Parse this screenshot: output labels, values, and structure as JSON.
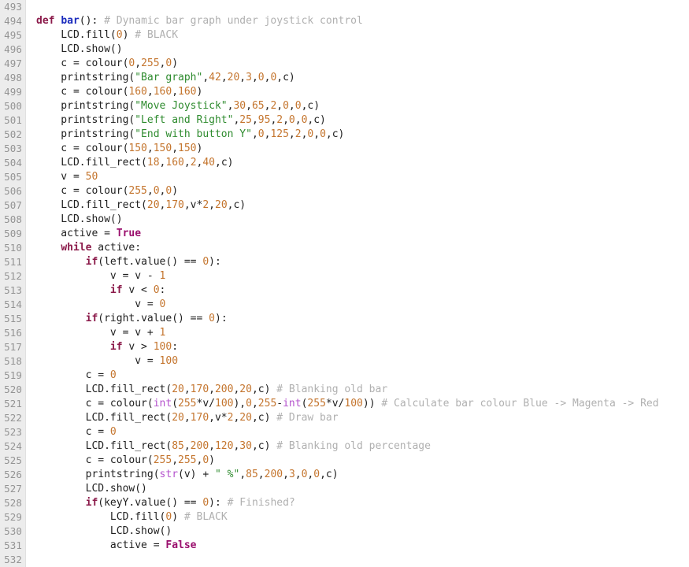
{
  "editor": {
    "name": "python-code-viewer",
    "language": "Python",
    "first_line_number": 493,
    "last_line_number": 532,
    "colors": {
      "background": "#ffffff",
      "gutter_background": "#ececec",
      "gutter_text": "#949494",
      "default_text": "#202020",
      "keyword": "#8b1a4a",
      "constant": "#9a0f6d",
      "function_def": "#1a2bbd",
      "builtin": "#b452cd",
      "string": "#2e8b2e",
      "number": "#c4752e",
      "comment": "#b0b0b0"
    }
  },
  "lines": [
    {
      "n": "493",
      "tokens": []
    },
    {
      "n": "494",
      "tokens": [
        {
          "t": "kw",
          "s": "def"
        },
        {
          "t": "plain",
          "s": " "
        },
        {
          "t": "fn",
          "s": "bar"
        },
        {
          "t": "plain",
          "s": "(): "
        },
        {
          "t": "comment",
          "s": "# Dynamic bar graph under joystick control"
        }
      ]
    },
    {
      "n": "495",
      "tokens": [
        {
          "t": "plain",
          "s": "    LCD.fill("
        },
        {
          "t": "num",
          "s": "0"
        },
        {
          "t": "plain",
          "s": ") "
        },
        {
          "t": "comment",
          "s": "# BLACK"
        }
      ]
    },
    {
      "n": "496",
      "tokens": [
        {
          "t": "plain",
          "s": "    LCD.show()"
        }
      ]
    },
    {
      "n": "497",
      "tokens": [
        {
          "t": "plain",
          "s": "    c = colour("
        },
        {
          "t": "num",
          "s": "0"
        },
        {
          "t": "plain",
          "s": ","
        },
        {
          "t": "num",
          "s": "255"
        },
        {
          "t": "plain",
          "s": ","
        },
        {
          "t": "num",
          "s": "0"
        },
        {
          "t": "plain",
          "s": ")"
        }
      ]
    },
    {
      "n": "498",
      "tokens": [
        {
          "t": "plain",
          "s": "    printstring("
        },
        {
          "t": "str",
          "s": "\"Bar graph\""
        },
        {
          "t": "plain",
          "s": ","
        },
        {
          "t": "num",
          "s": "42"
        },
        {
          "t": "plain",
          "s": ","
        },
        {
          "t": "num",
          "s": "20"
        },
        {
          "t": "plain",
          "s": ","
        },
        {
          "t": "num",
          "s": "3"
        },
        {
          "t": "plain",
          "s": ","
        },
        {
          "t": "num",
          "s": "0"
        },
        {
          "t": "plain",
          "s": ","
        },
        {
          "t": "num",
          "s": "0"
        },
        {
          "t": "plain",
          "s": ",c)"
        }
      ]
    },
    {
      "n": "499",
      "tokens": [
        {
          "t": "plain",
          "s": "    c = colour("
        },
        {
          "t": "num",
          "s": "160"
        },
        {
          "t": "plain",
          "s": ","
        },
        {
          "t": "num",
          "s": "160"
        },
        {
          "t": "plain",
          "s": ","
        },
        {
          "t": "num",
          "s": "160"
        },
        {
          "t": "plain",
          "s": ")"
        }
      ]
    },
    {
      "n": "500",
      "tokens": [
        {
          "t": "plain",
          "s": "    printstring("
        },
        {
          "t": "str",
          "s": "\"Move Joystick\""
        },
        {
          "t": "plain",
          "s": ","
        },
        {
          "t": "num",
          "s": "30"
        },
        {
          "t": "plain",
          "s": ","
        },
        {
          "t": "num",
          "s": "65"
        },
        {
          "t": "plain",
          "s": ","
        },
        {
          "t": "num",
          "s": "2"
        },
        {
          "t": "plain",
          "s": ","
        },
        {
          "t": "num",
          "s": "0"
        },
        {
          "t": "plain",
          "s": ","
        },
        {
          "t": "num",
          "s": "0"
        },
        {
          "t": "plain",
          "s": ",c)"
        }
      ]
    },
    {
      "n": "501",
      "tokens": [
        {
          "t": "plain",
          "s": "    printstring("
        },
        {
          "t": "str",
          "s": "\"Left and Right\""
        },
        {
          "t": "plain",
          "s": ","
        },
        {
          "t": "num",
          "s": "25"
        },
        {
          "t": "plain",
          "s": ","
        },
        {
          "t": "num",
          "s": "95"
        },
        {
          "t": "plain",
          "s": ","
        },
        {
          "t": "num",
          "s": "2"
        },
        {
          "t": "plain",
          "s": ","
        },
        {
          "t": "num",
          "s": "0"
        },
        {
          "t": "plain",
          "s": ","
        },
        {
          "t": "num",
          "s": "0"
        },
        {
          "t": "plain",
          "s": ",c)"
        }
      ]
    },
    {
      "n": "502",
      "tokens": [
        {
          "t": "plain",
          "s": "    printstring("
        },
        {
          "t": "str",
          "s": "\"End with button Y\""
        },
        {
          "t": "plain",
          "s": ","
        },
        {
          "t": "num",
          "s": "0"
        },
        {
          "t": "plain",
          "s": ","
        },
        {
          "t": "num",
          "s": "125"
        },
        {
          "t": "plain",
          "s": ","
        },
        {
          "t": "num",
          "s": "2"
        },
        {
          "t": "plain",
          "s": ","
        },
        {
          "t": "num",
          "s": "0"
        },
        {
          "t": "plain",
          "s": ","
        },
        {
          "t": "num",
          "s": "0"
        },
        {
          "t": "plain",
          "s": ",c)"
        }
      ]
    },
    {
      "n": "503",
      "tokens": [
        {
          "t": "plain",
          "s": "    c = colour("
        },
        {
          "t": "num",
          "s": "150"
        },
        {
          "t": "plain",
          "s": ","
        },
        {
          "t": "num",
          "s": "150"
        },
        {
          "t": "plain",
          "s": ","
        },
        {
          "t": "num",
          "s": "150"
        },
        {
          "t": "plain",
          "s": ")"
        }
      ]
    },
    {
      "n": "504",
      "tokens": [
        {
          "t": "plain",
          "s": "    LCD.fill_rect("
        },
        {
          "t": "num",
          "s": "18"
        },
        {
          "t": "plain",
          "s": ","
        },
        {
          "t": "num",
          "s": "160"
        },
        {
          "t": "plain",
          "s": ","
        },
        {
          "t": "num",
          "s": "2"
        },
        {
          "t": "plain",
          "s": ","
        },
        {
          "t": "num",
          "s": "40"
        },
        {
          "t": "plain",
          "s": ",c)"
        }
      ]
    },
    {
      "n": "505",
      "tokens": [
        {
          "t": "plain",
          "s": "    v = "
        },
        {
          "t": "num",
          "s": "50"
        }
      ]
    },
    {
      "n": "506",
      "tokens": [
        {
          "t": "plain",
          "s": "    c = colour("
        },
        {
          "t": "num",
          "s": "255"
        },
        {
          "t": "plain",
          "s": ","
        },
        {
          "t": "num",
          "s": "0"
        },
        {
          "t": "plain",
          "s": ","
        },
        {
          "t": "num",
          "s": "0"
        },
        {
          "t": "plain",
          "s": ")"
        }
      ]
    },
    {
      "n": "507",
      "tokens": [
        {
          "t": "plain",
          "s": "    LCD.fill_rect("
        },
        {
          "t": "num",
          "s": "20"
        },
        {
          "t": "plain",
          "s": ","
        },
        {
          "t": "num",
          "s": "170"
        },
        {
          "t": "plain",
          "s": ",v*"
        },
        {
          "t": "num",
          "s": "2"
        },
        {
          "t": "plain",
          "s": ","
        },
        {
          "t": "num",
          "s": "20"
        },
        {
          "t": "plain",
          "s": ",c)"
        }
      ]
    },
    {
      "n": "508",
      "tokens": [
        {
          "t": "plain",
          "s": "    LCD.show()"
        }
      ]
    },
    {
      "n": "509",
      "tokens": [
        {
          "t": "plain",
          "s": "    active = "
        },
        {
          "t": "kw2",
          "s": "True"
        }
      ]
    },
    {
      "n": "510",
      "tokens": [
        {
          "t": "plain",
          "s": "    "
        },
        {
          "t": "kw",
          "s": "while"
        },
        {
          "t": "plain",
          "s": " active:"
        }
      ]
    },
    {
      "n": "511",
      "tokens": [
        {
          "t": "plain",
          "s": "        "
        },
        {
          "t": "kw",
          "s": "if"
        },
        {
          "t": "plain",
          "s": "(left.value() == "
        },
        {
          "t": "num",
          "s": "0"
        },
        {
          "t": "plain",
          "s": "):"
        }
      ]
    },
    {
      "n": "512",
      "tokens": [
        {
          "t": "plain",
          "s": "            v = v - "
        },
        {
          "t": "num",
          "s": "1"
        }
      ]
    },
    {
      "n": "513",
      "tokens": [
        {
          "t": "plain",
          "s": "            "
        },
        {
          "t": "kw",
          "s": "if"
        },
        {
          "t": "plain",
          "s": " v < "
        },
        {
          "t": "num",
          "s": "0"
        },
        {
          "t": "plain",
          "s": ":"
        }
      ]
    },
    {
      "n": "514",
      "tokens": [
        {
          "t": "plain",
          "s": "                v = "
        },
        {
          "t": "num",
          "s": "0"
        }
      ]
    },
    {
      "n": "515",
      "tokens": [
        {
          "t": "plain",
          "s": "        "
        },
        {
          "t": "kw",
          "s": "if"
        },
        {
          "t": "plain",
          "s": "(right.value() == "
        },
        {
          "t": "num",
          "s": "0"
        },
        {
          "t": "plain",
          "s": "):"
        }
      ]
    },
    {
      "n": "516",
      "tokens": [
        {
          "t": "plain",
          "s": "            v = v + "
        },
        {
          "t": "num",
          "s": "1"
        }
      ]
    },
    {
      "n": "517",
      "tokens": [
        {
          "t": "plain",
          "s": "            "
        },
        {
          "t": "kw",
          "s": "if"
        },
        {
          "t": "plain",
          "s": " v > "
        },
        {
          "t": "num",
          "s": "100"
        },
        {
          "t": "plain",
          "s": ":"
        }
      ]
    },
    {
      "n": "518",
      "tokens": [
        {
          "t": "plain",
          "s": "                v = "
        },
        {
          "t": "num",
          "s": "100"
        }
      ]
    },
    {
      "n": "519",
      "tokens": [
        {
          "t": "plain",
          "s": "        c = "
        },
        {
          "t": "num",
          "s": "0"
        }
      ]
    },
    {
      "n": "520",
      "tokens": [
        {
          "t": "plain",
          "s": "        LCD.fill_rect("
        },
        {
          "t": "num",
          "s": "20"
        },
        {
          "t": "plain",
          "s": ","
        },
        {
          "t": "num",
          "s": "170"
        },
        {
          "t": "plain",
          "s": ","
        },
        {
          "t": "num",
          "s": "200"
        },
        {
          "t": "plain",
          "s": ","
        },
        {
          "t": "num",
          "s": "20"
        },
        {
          "t": "plain",
          "s": ",c) "
        },
        {
          "t": "comment",
          "s": "# Blanking old bar"
        }
      ]
    },
    {
      "n": "521",
      "tokens": [
        {
          "t": "plain",
          "s": "        c = colour("
        },
        {
          "t": "builtin",
          "s": "int"
        },
        {
          "t": "plain",
          "s": "("
        },
        {
          "t": "num",
          "s": "255"
        },
        {
          "t": "plain",
          "s": "*v/"
        },
        {
          "t": "num",
          "s": "100"
        },
        {
          "t": "plain",
          "s": "),"
        },
        {
          "t": "num",
          "s": "0"
        },
        {
          "t": "plain",
          "s": ","
        },
        {
          "t": "num",
          "s": "255"
        },
        {
          "t": "plain",
          "s": "-"
        },
        {
          "t": "builtin",
          "s": "int"
        },
        {
          "t": "plain",
          "s": "("
        },
        {
          "t": "num",
          "s": "255"
        },
        {
          "t": "plain",
          "s": "*v/"
        },
        {
          "t": "num",
          "s": "100"
        },
        {
          "t": "plain",
          "s": ")) "
        },
        {
          "t": "comment",
          "s": "# Calculate bar colour Blue -> Magenta -> Red"
        }
      ]
    },
    {
      "n": "522",
      "tokens": [
        {
          "t": "plain",
          "s": "        LCD.fill_rect("
        },
        {
          "t": "num",
          "s": "20"
        },
        {
          "t": "plain",
          "s": ","
        },
        {
          "t": "num",
          "s": "170"
        },
        {
          "t": "plain",
          "s": ",v*"
        },
        {
          "t": "num",
          "s": "2"
        },
        {
          "t": "plain",
          "s": ","
        },
        {
          "t": "num",
          "s": "20"
        },
        {
          "t": "plain",
          "s": ",c) "
        },
        {
          "t": "comment",
          "s": "# Draw bar"
        }
      ]
    },
    {
      "n": "523",
      "tokens": [
        {
          "t": "plain",
          "s": "        c = "
        },
        {
          "t": "num",
          "s": "0"
        }
      ]
    },
    {
      "n": "524",
      "tokens": [
        {
          "t": "plain",
          "s": "        LCD.fill_rect("
        },
        {
          "t": "num",
          "s": "85"
        },
        {
          "t": "plain",
          "s": ","
        },
        {
          "t": "num",
          "s": "200"
        },
        {
          "t": "plain",
          "s": ","
        },
        {
          "t": "num",
          "s": "120"
        },
        {
          "t": "plain",
          "s": ","
        },
        {
          "t": "num",
          "s": "30"
        },
        {
          "t": "plain",
          "s": ",c) "
        },
        {
          "t": "comment",
          "s": "# Blanking old percentage"
        }
      ]
    },
    {
      "n": "525",
      "tokens": [
        {
          "t": "plain",
          "s": "        c = colour("
        },
        {
          "t": "num",
          "s": "255"
        },
        {
          "t": "plain",
          "s": ","
        },
        {
          "t": "num",
          "s": "255"
        },
        {
          "t": "plain",
          "s": ","
        },
        {
          "t": "num",
          "s": "0"
        },
        {
          "t": "plain",
          "s": ")"
        }
      ]
    },
    {
      "n": "526",
      "tokens": [
        {
          "t": "plain",
          "s": "        printstring("
        },
        {
          "t": "builtin",
          "s": "str"
        },
        {
          "t": "plain",
          "s": "(v) + "
        },
        {
          "t": "str",
          "s": "\" %\""
        },
        {
          "t": "plain",
          "s": ","
        },
        {
          "t": "num",
          "s": "85"
        },
        {
          "t": "plain",
          "s": ","
        },
        {
          "t": "num",
          "s": "200"
        },
        {
          "t": "plain",
          "s": ","
        },
        {
          "t": "num",
          "s": "3"
        },
        {
          "t": "plain",
          "s": ","
        },
        {
          "t": "num",
          "s": "0"
        },
        {
          "t": "plain",
          "s": ","
        },
        {
          "t": "num",
          "s": "0"
        },
        {
          "t": "plain",
          "s": ",c)"
        }
      ]
    },
    {
      "n": "527",
      "tokens": [
        {
          "t": "plain",
          "s": "        LCD.show()"
        }
      ]
    },
    {
      "n": "528",
      "tokens": [
        {
          "t": "plain",
          "s": "        "
        },
        {
          "t": "kw",
          "s": "if"
        },
        {
          "t": "plain",
          "s": "(keyY.value() == "
        },
        {
          "t": "num",
          "s": "0"
        },
        {
          "t": "plain",
          "s": "): "
        },
        {
          "t": "comment",
          "s": "# Finished?"
        }
      ]
    },
    {
      "n": "529",
      "tokens": [
        {
          "t": "plain",
          "s": "            LCD.fill("
        },
        {
          "t": "num",
          "s": "0"
        },
        {
          "t": "plain",
          "s": ") "
        },
        {
          "t": "comment",
          "s": "# BLACK"
        }
      ]
    },
    {
      "n": "530",
      "tokens": [
        {
          "t": "plain",
          "s": "            LCD.show()"
        }
      ]
    },
    {
      "n": "531",
      "tokens": [
        {
          "t": "plain",
          "s": "            active = "
        },
        {
          "t": "kw2",
          "s": "False"
        }
      ]
    },
    {
      "n": "532",
      "tokens": []
    }
  ]
}
